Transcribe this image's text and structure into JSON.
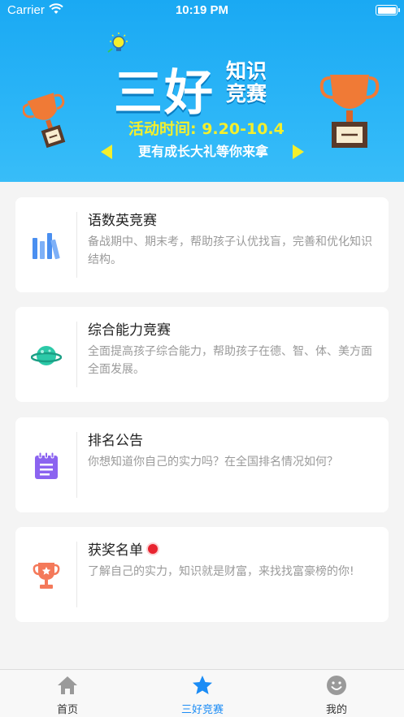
{
  "status_bar": {
    "carrier": "Carrier",
    "time": "10:19 PM"
  },
  "banner": {
    "title_big": "三好",
    "title_small": "知识竞赛",
    "activity_time": "活动时间: 9.20-10.4",
    "slogan": "更有成长大礼等你来拿"
  },
  "cards": [
    {
      "icon": "books-icon",
      "title": "语数英竞赛",
      "desc": "备战期中、期末考，帮助孩子认优找盲，完善和优化知识结构。",
      "accent": "#4a8ff0"
    },
    {
      "icon": "planet-icon",
      "title": "综合能力竞赛",
      "desc": "全面提高孩子综合能力，帮助孩子在德、智、体、美方面全面发展。",
      "accent": "#2cc9a8"
    },
    {
      "icon": "notepad-icon",
      "title": "排名公告",
      "desc": "你想知道你自己的实力吗？在全国排名情况如何？",
      "accent": "#8b63f0"
    },
    {
      "icon": "trophy-icon",
      "title": "获奖名单",
      "desc": "了解自己的实力，知识就是财富，来找找富豪榜的你!",
      "accent": "#f4795a"
    }
  ],
  "tabs": [
    {
      "icon": "home-icon",
      "label": "首页",
      "active": false
    },
    {
      "icon": "star-icon",
      "label": "三好竞赛",
      "active": true
    },
    {
      "icon": "smiley-icon",
      "label": "我的",
      "active": false
    }
  ],
  "colors": {
    "banner": "#1aa9f3",
    "tab_active": "#1b8cf5",
    "tab_inactive": "#9a9a9a",
    "badge": "#e8232f"
  }
}
